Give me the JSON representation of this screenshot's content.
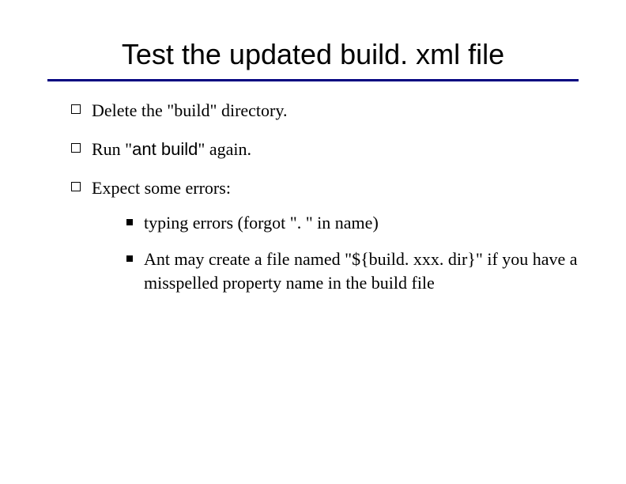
{
  "title": "Test the updated build. xml file",
  "bullets": {
    "b1": "Delete the \"build\" directory.",
    "b2_pre": "Run \"",
    "b2_cmd": "ant build",
    "b2_post": "\" again.",
    "b3": "Expect some errors:",
    "sub1": "typing errors (forgot \". \" in name)",
    "sub2": "Ant may create a file named \"${build. xxx. dir}\" if you have a misspelled property name in the build file"
  }
}
